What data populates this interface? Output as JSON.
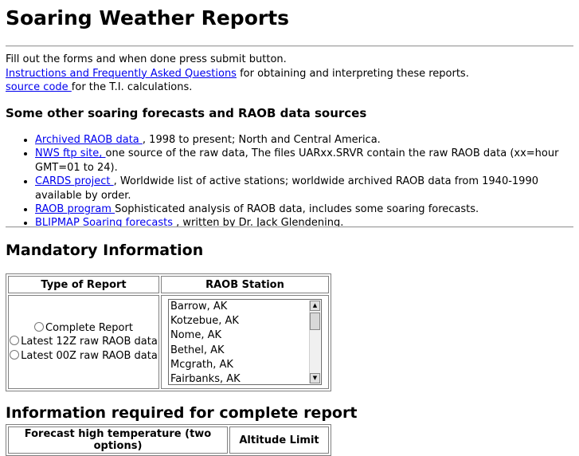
{
  "page": {
    "title": "Soaring Weather Reports"
  },
  "intro": {
    "line1": "Fill out the forms and when done press submit button.",
    "faq_link": "Instructions and Frequently Asked Questions",
    "faq_suffix": " for obtaining and interpreting these reports.",
    "source_link": "source code ",
    "source_suffix": "for the T.I. calculations."
  },
  "sources": {
    "heading": "Some other soaring forecasts and RAOB data sources",
    "items": [
      {
        "link": "Archived RAOB data ",
        "text": ", 1998 to present; North and Central America."
      },
      {
        "link": "NWS ftp site, ",
        "text": "one source of the raw data, The files UARxx.SRVR contain the raw RAOB data (xx=hour GMT=01 to 24)."
      },
      {
        "link": "CARDS project ",
        "text": ", Worldwide list of active stations; worldwide archived RAOB data from 1940-1990 available by order."
      },
      {
        "link": "RAOB program ",
        "text": "Sophisticated analysis of RAOB data, includes some soaring forecasts."
      },
      {
        "link": "BLIPMAP Soaring forecasts ",
        "text": ", written by Dr. Jack Glendening."
      }
    ]
  },
  "mandatory": {
    "heading": "Mandatory Information",
    "col_report": "Type of Report",
    "col_station": "RAOB Station",
    "report_options": [
      "Complete Report",
      "Latest 12Z raw RAOB data",
      "Latest 00Z raw RAOB data"
    ],
    "stations": [
      "Barrow, AK",
      "Kotzebue, AK",
      "Nome, AK",
      "Bethel, AK",
      "Mcgrath, AK",
      "Fairbanks, AK"
    ]
  },
  "complete": {
    "heading": "Information required for complete report",
    "col_forecast": "Forecast high temperature (two options)",
    "col_altitude": "Altitude Limit"
  }
}
